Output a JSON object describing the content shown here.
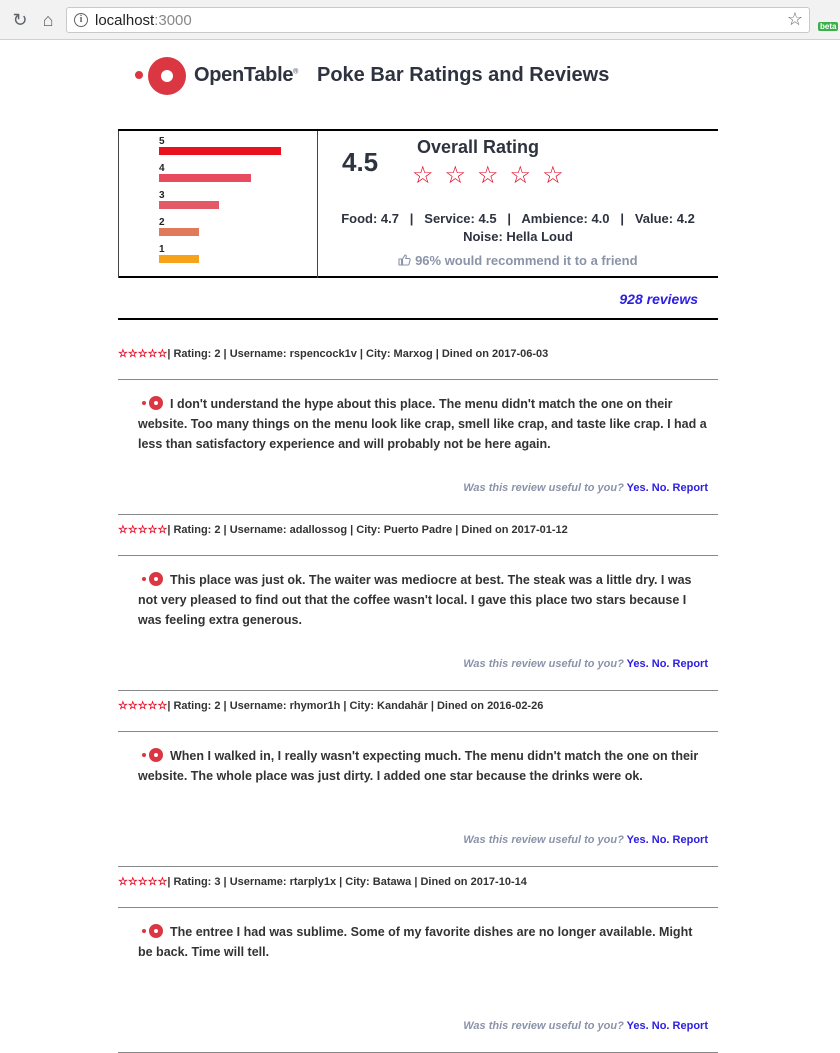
{
  "browser": {
    "url_host": "localhost",
    "url_port": ":3000",
    "ext_badge": "beta"
  },
  "header": {
    "logo_text": "OpenTable",
    "logo_mark": "®",
    "title": "Poke Bar Ratings and Reviews"
  },
  "summary": {
    "distribution": [
      {
        "label": "5",
        "value": 0.61,
        "color": "#e8121e"
      },
      {
        "label": "4",
        "value": 0.46,
        "color": "#e84a5f"
      },
      {
        "label": "3",
        "value": 0.3,
        "color": "#e35a66"
      },
      {
        "label": "2",
        "value": 0.2,
        "color": "#e07a5a"
      },
      {
        "label": "1",
        "value": 0.2,
        "color": "#f7a21b"
      }
    ],
    "score": "4.5",
    "overall_title": "Overall Rating",
    "stars": "☆☆☆☆☆",
    "subratings": "Food: 4.7   |   Service: 4.5   |   Ambience: 4.0   |   Value: 4.2",
    "noise": "Noise: Hella Loud",
    "recommend": "96% would recommend it to a friend",
    "review_count": "928 reviews"
  },
  "reviews": [
    {
      "stars": "☆☆☆☆☆",
      "meta": "| Rating: 2 | Username: rspencock1v | City: Marxog | Dined on 2017-06-03",
      "body": "I don't understand the hype about this place. The menu didn't match the one on their website. Too many things on the menu look like crap, smell like crap, and taste like crap. I had a less than satisfactory experience and will probably not be here again.",
      "useful_q": "Was this review useful to you?",
      "yes": "Yes.",
      "no": "No.",
      "report": "Report"
    },
    {
      "stars": "☆☆☆☆☆",
      "meta": "| Rating: 2 | Username: adallossog | City: Puerto Padre | Dined on 2017-01-12",
      "body": "This place was just ok. The waiter was mediocre at best. The steak was a little dry. I was not very pleased to find out that the coffee wasn't local. I gave this place two stars because I was feeling extra generous.",
      "useful_q": "Was this review useful to you?",
      "yes": "Yes.",
      "no": "No.",
      "report": "Report"
    },
    {
      "stars": "☆☆☆☆☆",
      "meta": "| Rating: 2 | Username: rhymor1h | City: Kandahār | Dined on 2016-02-26",
      "body": "When I walked in, I really wasn't expecting much. The menu didn't match the one on their website. The whole place was just dirty. I added one star because the drinks were ok.",
      "useful_q": "Was this review useful to you?",
      "yes": "Yes.",
      "no": "No.",
      "report": "Report"
    },
    {
      "stars": "☆☆☆☆☆",
      "meta": "| Rating: 3 | Username: rtarply1x | City: Batawa | Dined on 2017-10-14",
      "body": "The entree I had was sublime. Some of my favorite dishes are no longer available. Might be back. Time will tell.",
      "useful_q": "Was this review useful to you?",
      "yes": "Yes.",
      "no": "No.",
      "report": "Report"
    }
  ]
}
